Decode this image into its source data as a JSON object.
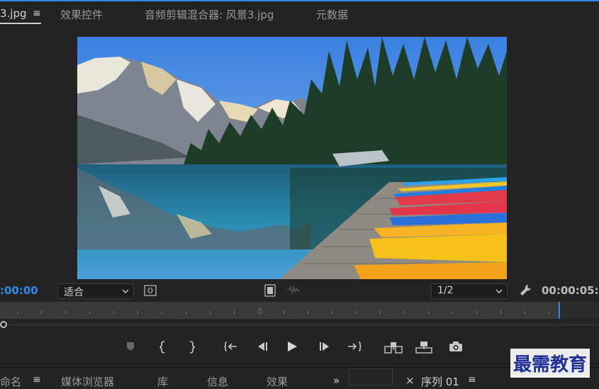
{
  "top_tabs": [
    {
      "label": "3.jpg",
      "active": true
    },
    {
      "label": "效果控件"
    },
    {
      "label": "音频剪辑混合器: 风景3.jpg"
    },
    {
      "label": "元数据"
    }
  ],
  "menu_symbol": "≡",
  "controls": {
    "timecode_left": ":00:00",
    "zoom_select": "适合",
    "resolution_select": "1/2",
    "timecode_right": "00:00:05:0"
  },
  "bottom_tabs": [
    {
      "label": "命名"
    },
    {
      "label": "媒体浏览器"
    },
    {
      "label": "库"
    },
    {
      "label": "信息"
    },
    {
      "label": "效果"
    },
    {
      "label": "»"
    },
    {
      "label": "序列 01",
      "active": true
    }
  ],
  "watermark": "最需教育",
  "colors": {
    "accent": "#2d8ceb"
  }
}
